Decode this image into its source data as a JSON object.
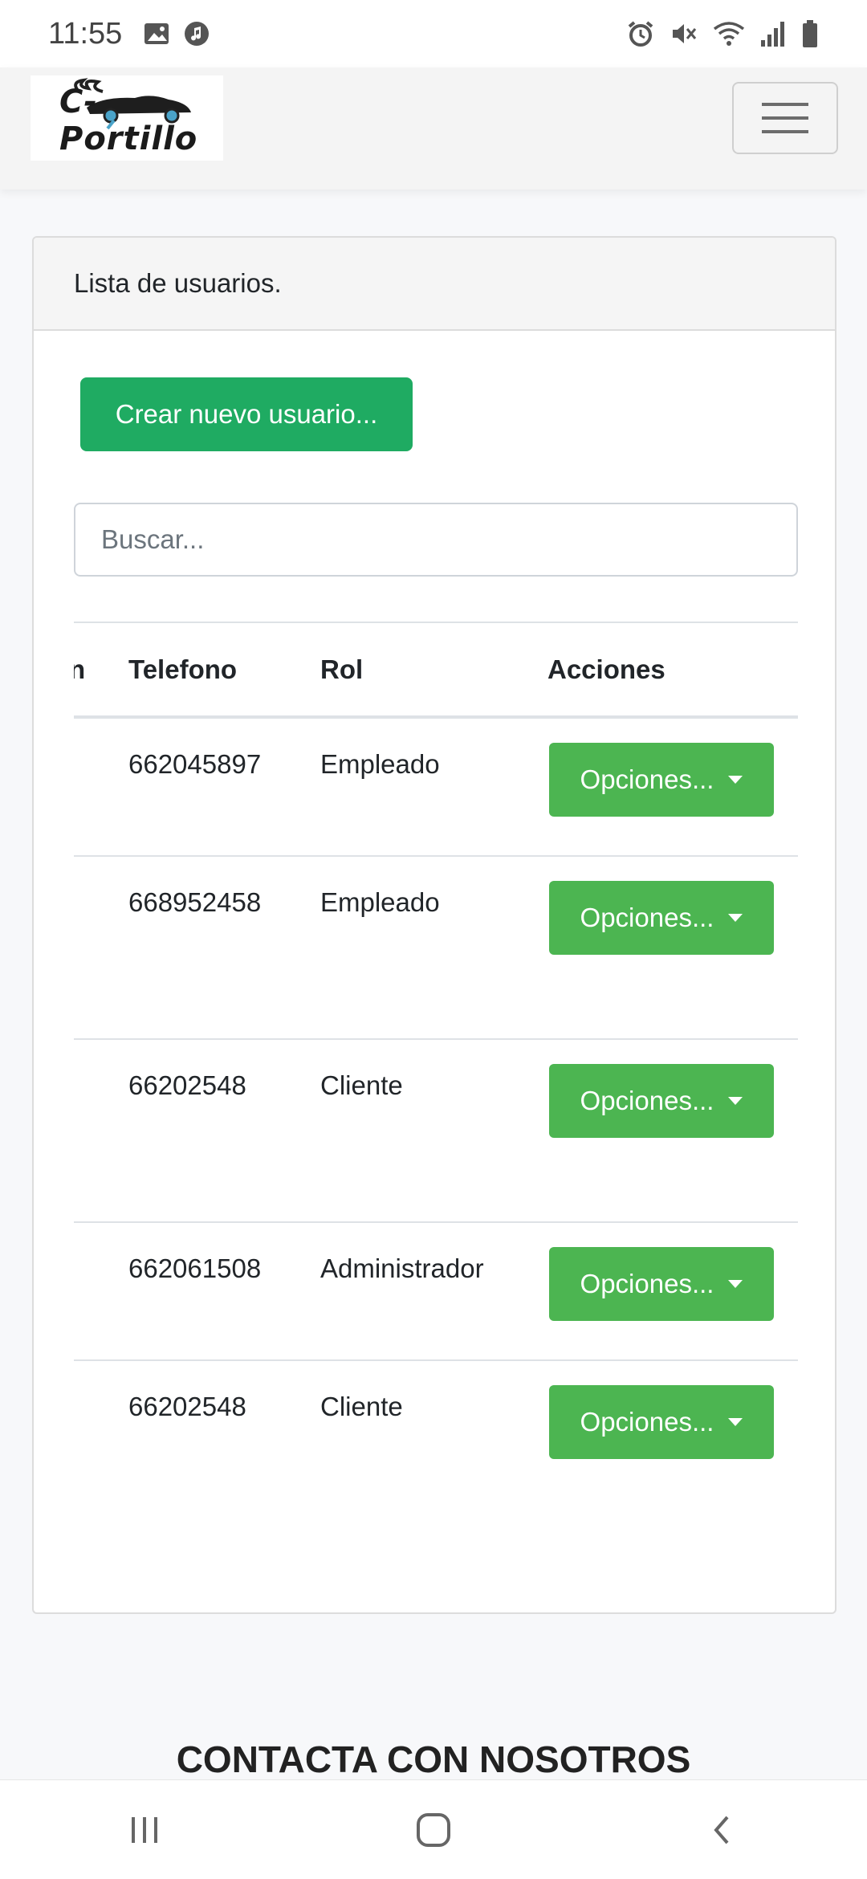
{
  "status_bar": {
    "time": "11:55"
  },
  "navbar": {
    "logo_text": "C-Portillo"
  },
  "card": {
    "header": "Lista de usuarios.",
    "create_button": "Crear nuevo usuario...",
    "search_placeholder": "Buscar..."
  },
  "table": {
    "columns": [
      "n",
      "Telefono",
      "Rol",
      "Acciones"
    ],
    "rows": [
      {
        "telefono": "662045897",
        "rol": "Empleado",
        "action": "Opciones..."
      },
      {
        "telefono": "668952458",
        "rol": "Empleado",
        "action": "Opciones..."
      },
      {
        "telefono": "66202548",
        "rol": "Cliente",
        "action": "Opciones..."
      },
      {
        "telefono": "662061508",
        "rol": "Administrador",
        "action": "Opciones..."
      },
      {
        "telefono": "66202548",
        "rol": "Cliente",
        "action": "Opciones..."
      }
    ]
  },
  "footer": {
    "contact_title": "CONTACTA CON NOSOTROS"
  },
  "colors": {
    "create_button": "#1fab62",
    "options_button": "#4cb551",
    "card_header_bg": "#f5f5f5"
  }
}
